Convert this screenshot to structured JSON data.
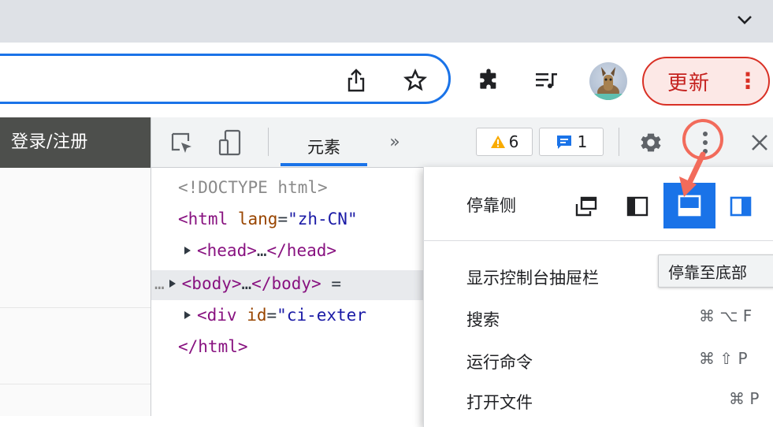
{
  "browser": {
    "tab_chevron_icon": "chevron-down-icon",
    "update_button": {
      "label": "更新",
      "menu": "⋮"
    },
    "toolbar_icons": [
      "share-icon",
      "star-icon",
      "extensions-puzzle-icon",
      "media-queue-icon",
      "profile-avatar"
    ]
  },
  "page": {
    "login_link": "登录/注册"
  },
  "devtools": {
    "tabs": {
      "elements": "元素",
      "more": "»"
    },
    "warnings": {
      "count": "6",
      "icon": "warning-triangle-icon",
      "color": "#f9ab00"
    },
    "messages": {
      "count": "1",
      "icon": "message-icon",
      "color": "#1a73e8"
    },
    "dom_lines": {
      "doctype": "<!DOCTYPE html>",
      "html_open": {
        "tag_open": "<html ",
        "attr": "lang",
        "eq": "=",
        "val": "\"zh-CN\""
      },
      "head": {
        "open": "<head>",
        "dots": "…",
        "close": "</head>"
      },
      "body": {
        "ellipsis": "…",
        "open": "<body>",
        "dots": "…",
        "close": "</body>",
        "suffix": " ="
      },
      "div": {
        "open": "<div ",
        "attr": "id",
        "eq": "=",
        "val": "\"ci-exter"
      },
      "html_close": "</html>"
    }
  },
  "menu": {
    "dock_side_label": "停靠侧",
    "tooltip": "停靠至底部",
    "items": [
      {
        "label": "显示控制台抽屉栏",
        "shortcut": ""
      },
      {
        "label": "搜索",
        "shortcut": "⌘ ⌥ F"
      },
      {
        "label": "运行命令",
        "shortcut": "⌘ ⇧ P"
      },
      {
        "label": "打开文件",
        "shortcut": "⌘ P"
      }
    ]
  },
  "colors": {
    "accent": "#1a73e8",
    "annotation": "#f26b5b",
    "update_red": "#d93025"
  }
}
